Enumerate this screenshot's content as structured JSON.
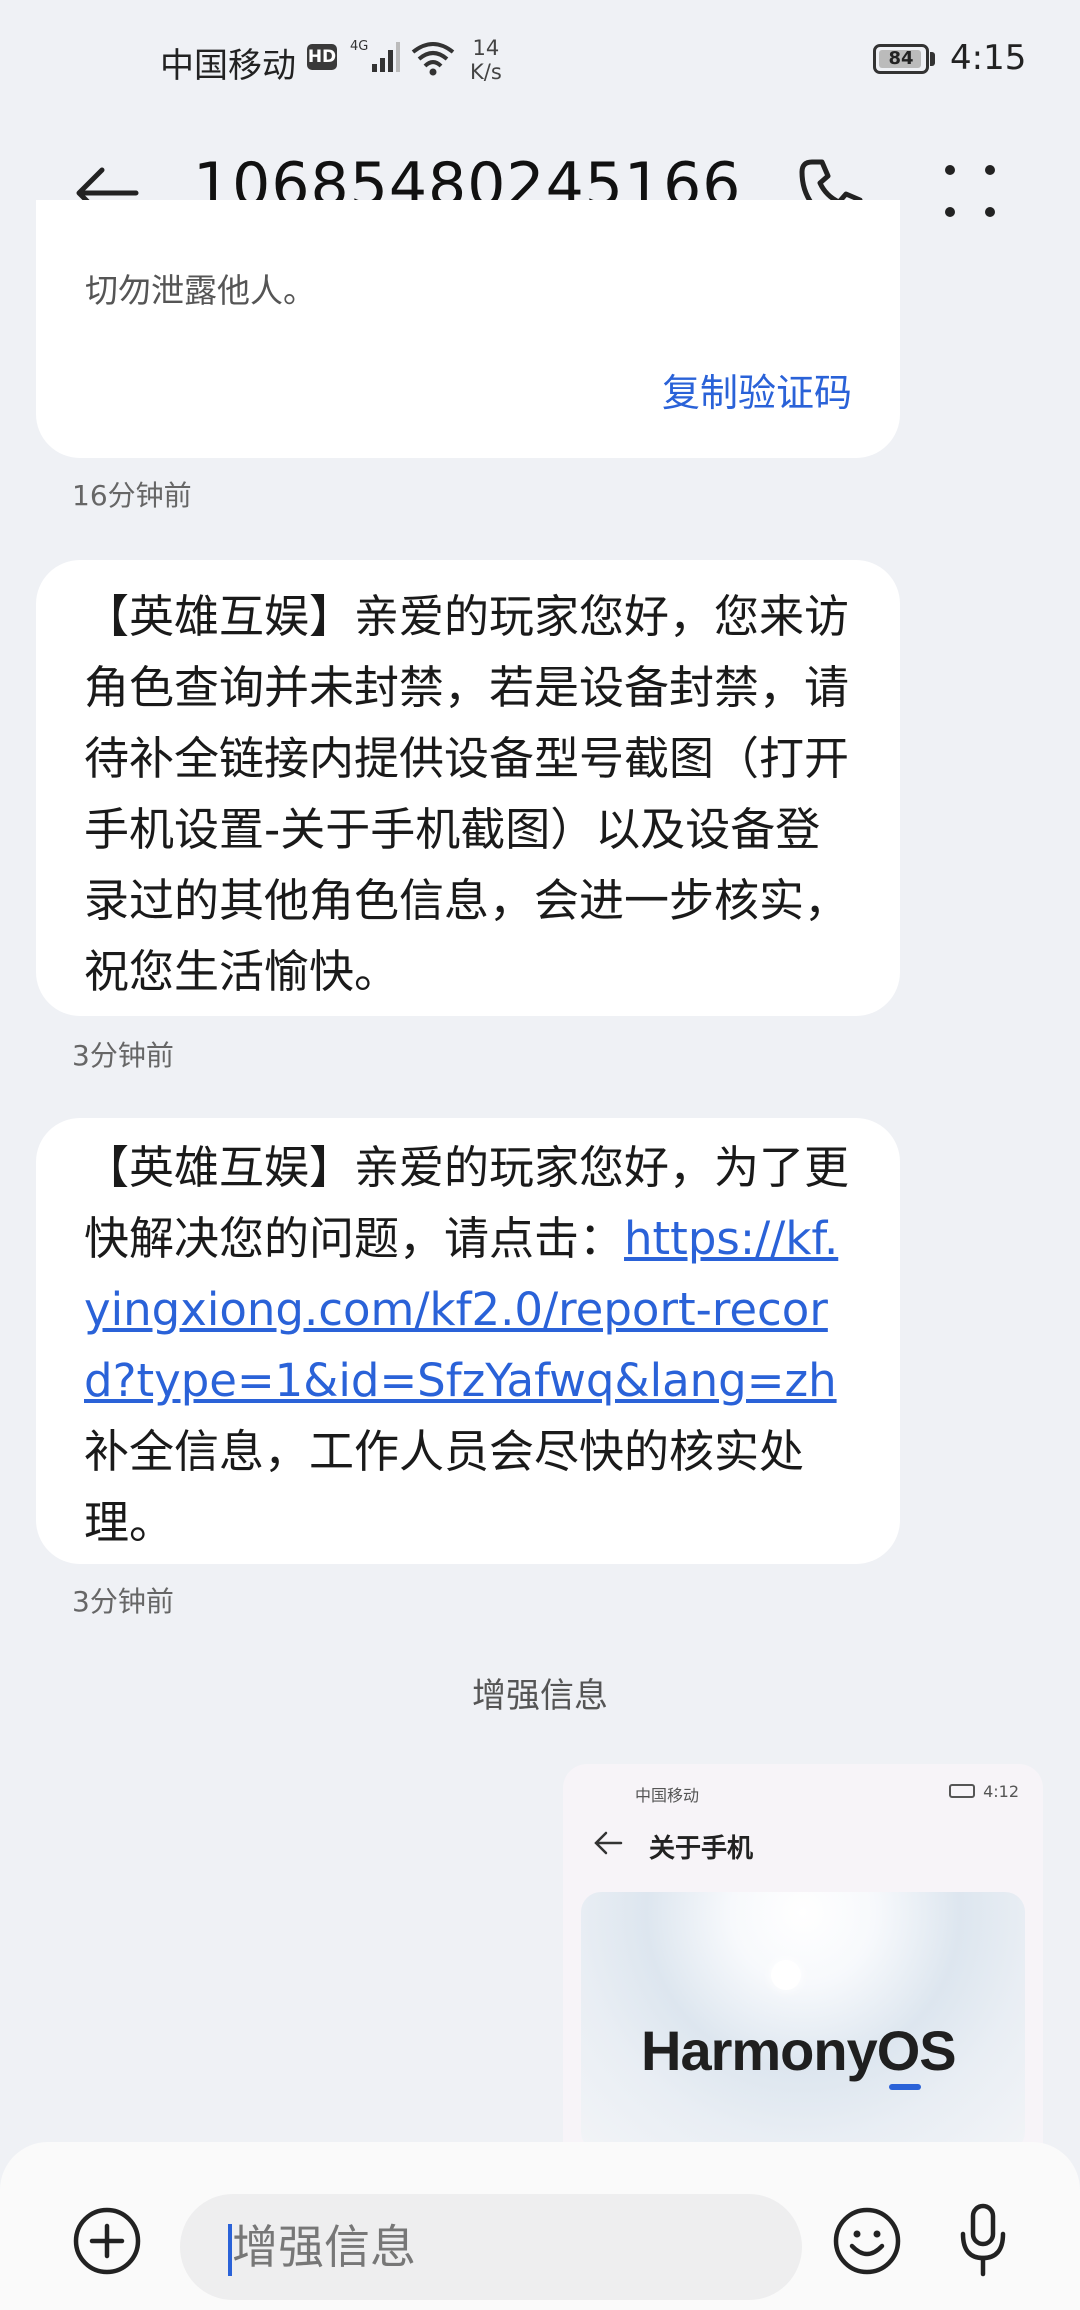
{
  "status_bar": {
    "carrier": "中国移动",
    "hd": "HD",
    "network": "4G",
    "speed_value": "14",
    "speed_unit": "K/s",
    "battery": "84",
    "time": "4:15"
  },
  "header": {
    "title": "10685480245166"
  },
  "messages": [
    {
      "clipped_text": "切勿泄露他人。",
      "action_label": "复制验证码",
      "time": "16分钟前"
    },
    {
      "text": "【英雄互娱】亲爱的玩家您好，您来访角色查询并未封禁，若是设备封禁，请待补全链接内提供设备型号截图（打开手机设置-关于手机截图）以及设备登录过的其他角色信息，会进一步核实，祝您生活愉快。",
      "time": "3分钟前"
    },
    {
      "text_before_link": "【英雄互娱】亲爱的玩家您好，为了更快解决您的问题，请点击：",
      "link": "https://kf.yingxiong.com/kf2.0/report-record?type=1&id=SfzYafwq&lang=zh",
      "text_after_link": " 补全信息，工作人员会尽快的核实处理。",
      "time": "3分钟前"
    }
  ],
  "enhanced_label": "增强信息",
  "attachment": {
    "status_carrier": "中国移动",
    "status_time": "4:12",
    "title": "关于手机",
    "logo_text": "HarmonyOS"
  },
  "composer": {
    "placeholder": "增强信息"
  },
  "colors": {
    "accent": "#2a62d8",
    "background": "#eff1f5",
    "bubble": "#ffffff"
  }
}
